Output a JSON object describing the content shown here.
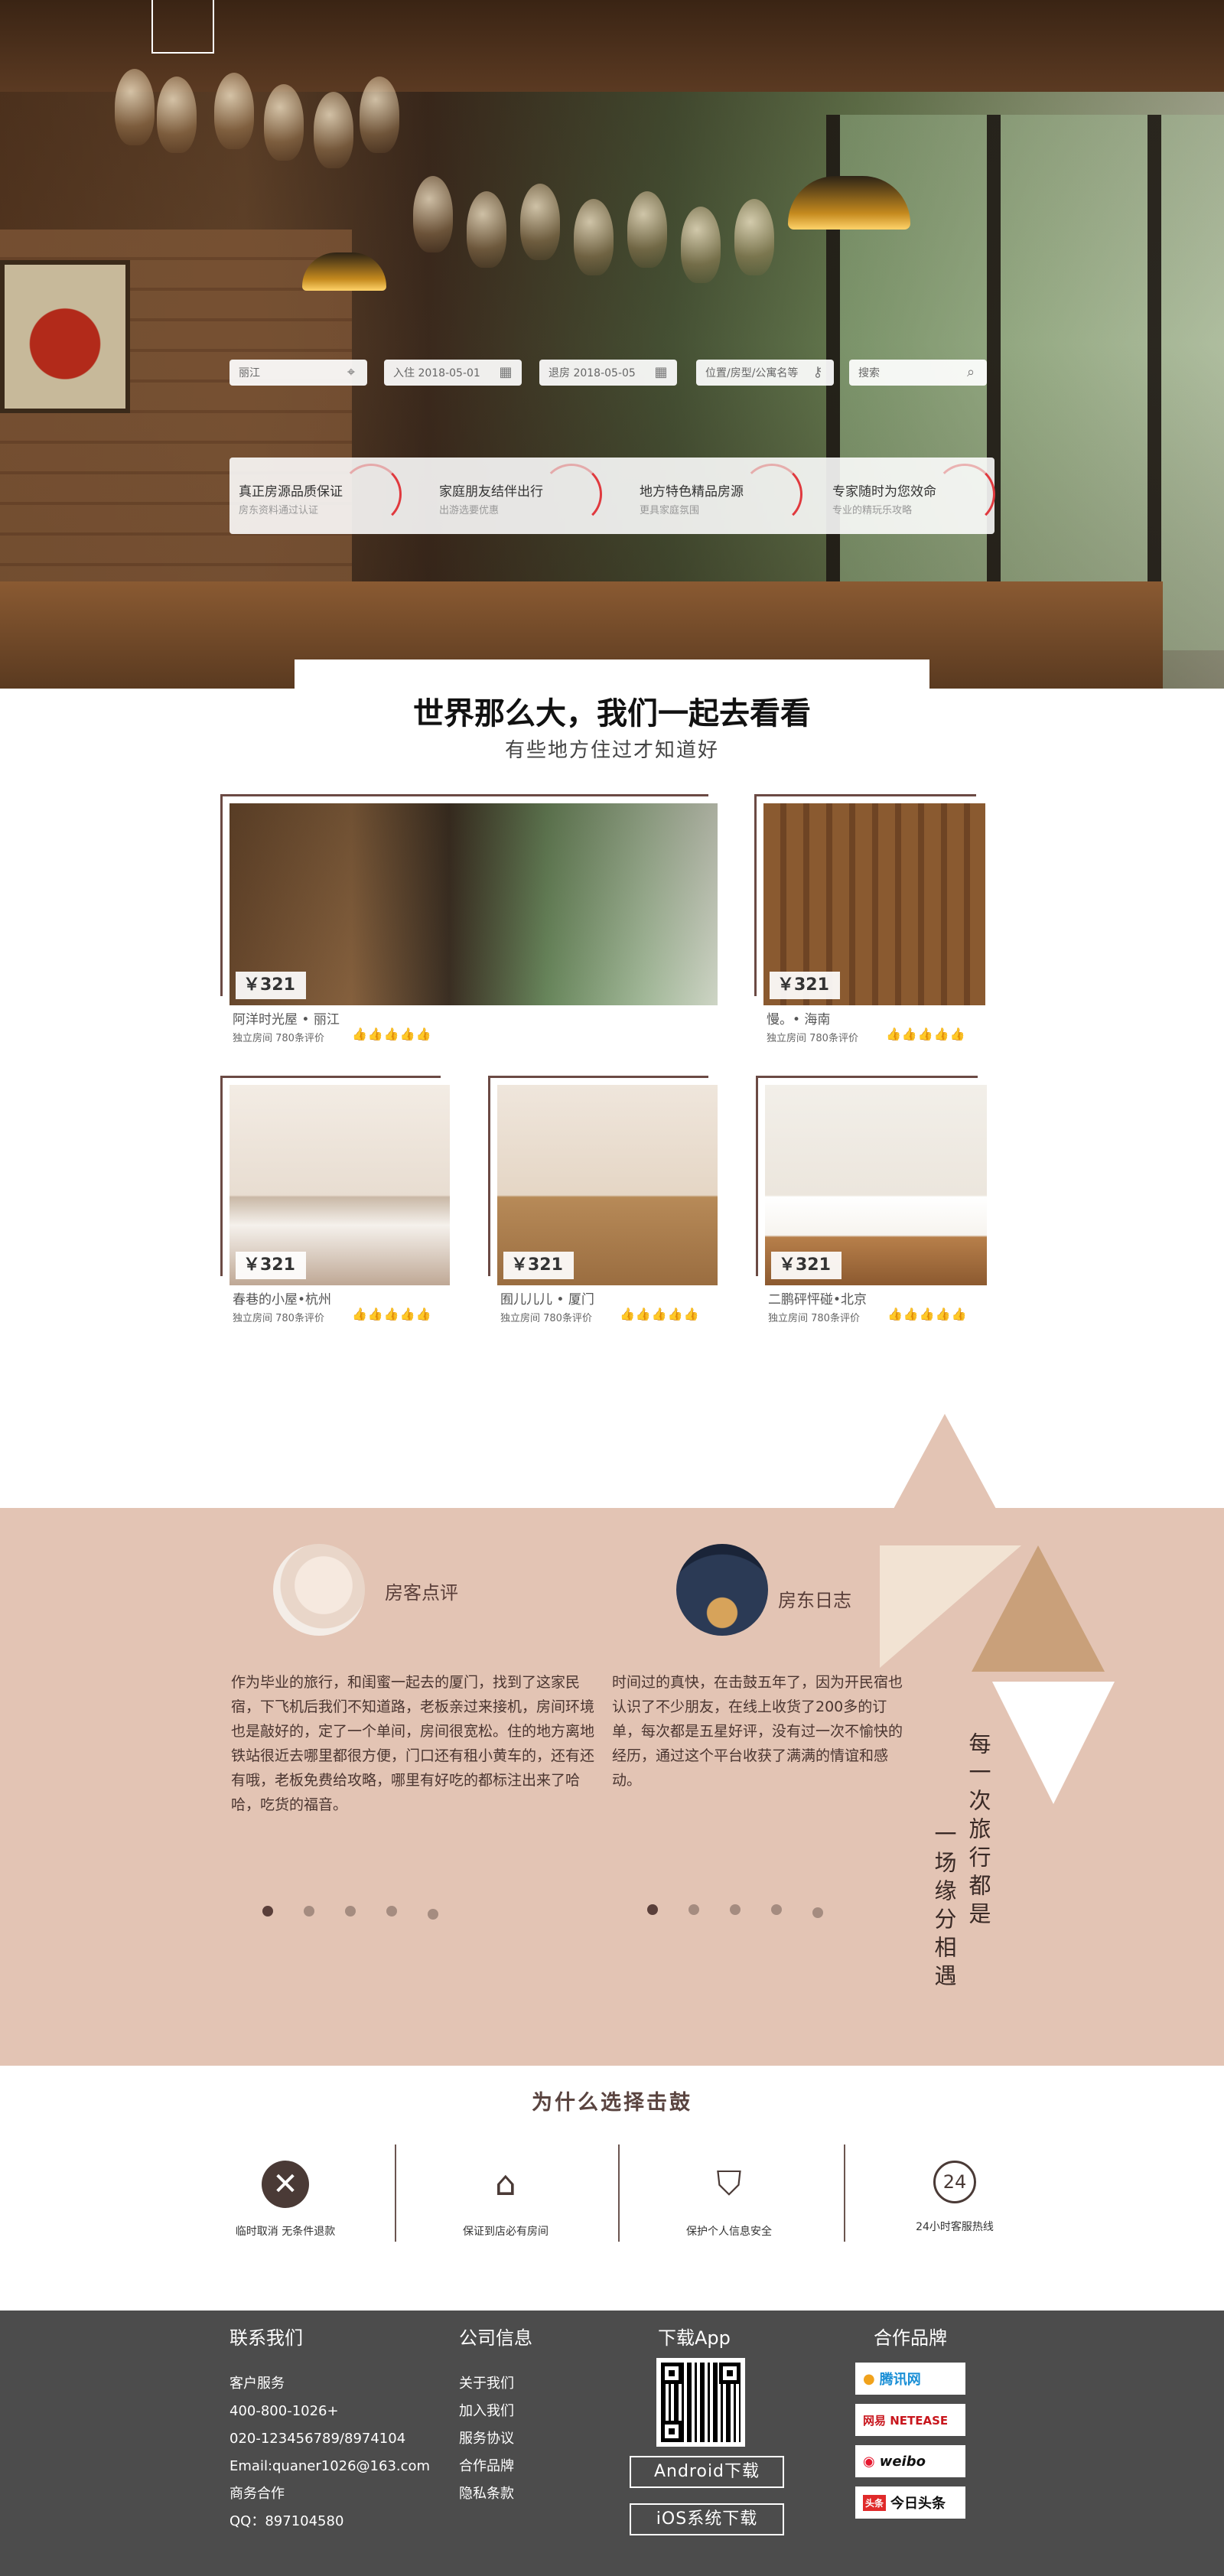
{
  "search": {
    "location": "丽江",
    "checkin": "入住 2018-05-01",
    "checkout": "退房 2018-05-05",
    "keywords": "位置/房型/公寓名等",
    "search_label": "搜索"
  },
  "features": [
    {
      "title": "真正房源品质保证",
      "sub": "房东资料通过认证"
    },
    {
      "title": "家庭朋友结伴出行",
      "sub": "出游选要优惠"
    },
    {
      "title": "地方特色精品房源",
      "sub": "更具家庭氛围"
    },
    {
      "title": "专家随时为您效命",
      "sub": "专业的精玩乐攻略"
    }
  ],
  "heading": {
    "title": "世界那么大，我们一起去看看",
    "subtitle": "有些地方住过才知道好"
  },
  "listings": [
    {
      "price": "￥321",
      "name": "阿洋时光屋 • 丽江",
      "meta": "独立房间  780条评价",
      "rating": 5
    },
    {
      "price": "￥321",
      "name": "慢。• 海南",
      "meta": "独立房间  780条评价",
      "rating": 5
    },
    {
      "price": "￥321",
      "name": "春巷的小屋•杭州",
      "meta": "独立房间  780条评价",
      "rating": 5
    },
    {
      "price": "￥321",
      "name": "囿儿儿儿 • 厦门",
      "meta": "独立房间  780条评价",
      "rating": 5
    },
    {
      "price": "￥321",
      "name": "二鹏砰怦碰•北京",
      "meta": "独立房间  780条评价",
      "rating": 5
    }
  ],
  "reviews": {
    "left_label": "房客点评",
    "left_text": "作为毕业的旅行，和闺蜜一起去的厦门，找到了这家民宿，下飞机后我们不知道路，老板亲过来接机，房间环境也是敲好的，定了一个单间，房间很宽松。住的地方离地铁站很近去哪里都很方便，门口还有租小黄车的，还有还有哦，老板免费给攻略，哪里有好吃的都标注出来了哈哈，吃货的福音。",
    "right_label": "房东日志",
    "right_text": "时间过的真快，在击鼓五年了，因为开民宿也认识了不少朋友，在线上收货了200多的订单，每次都是五星好评，没有过一次不愉快的经历，通过这个平台收获了满满的情谊和感动。",
    "slogan_1": "每一次旅行都是",
    "slogan_2": "一场缘分相遇"
  },
  "why": {
    "title": "为什么选择击鼓",
    "items": [
      {
        "icon": "cancel-circle-icon",
        "label": "临时取消 无条件退款"
      },
      {
        "icon": "home-icon",
        "label": "保证到店必有房间"
      },
      {
        "icon": "shield-icon",
        "label": "保护个人信息安全"
      },
      {
        "icon": "24h-service-icon",
        "label": "24小时客服热线"
      }
    ]
  },
  "footer": {
    "contact_title": "联系我们",
    "contact": [
      "客户服务",
      "400-800-1026+",
      "020-123456789/8974104",
      "Email:quaner1026@163.com",
      "商务合作",
      "QQ：897104580"
    ],
    "company_title": "公司信息",
    "company": [
      "关于我们",
      "加入我们",
      "服务协议",
      "合作品牌",
      "隐私条款"
    ],
    "app_title": "下载App",
    "android": "Android下载",
    "ios": "iOS系统下载",
    "partners_title": "合作品牌",
    "partners": [
      "腾讯网",
      "网易 NETEASE",
      "weibo",
      "今日头条"
    ]
  },
  "colors": {
    "band": "#e3c4b4",
    "footer": "#4c4c4c",
    "accent": "#e0393e",
    "frame": "#6b4a44"
  }
}
